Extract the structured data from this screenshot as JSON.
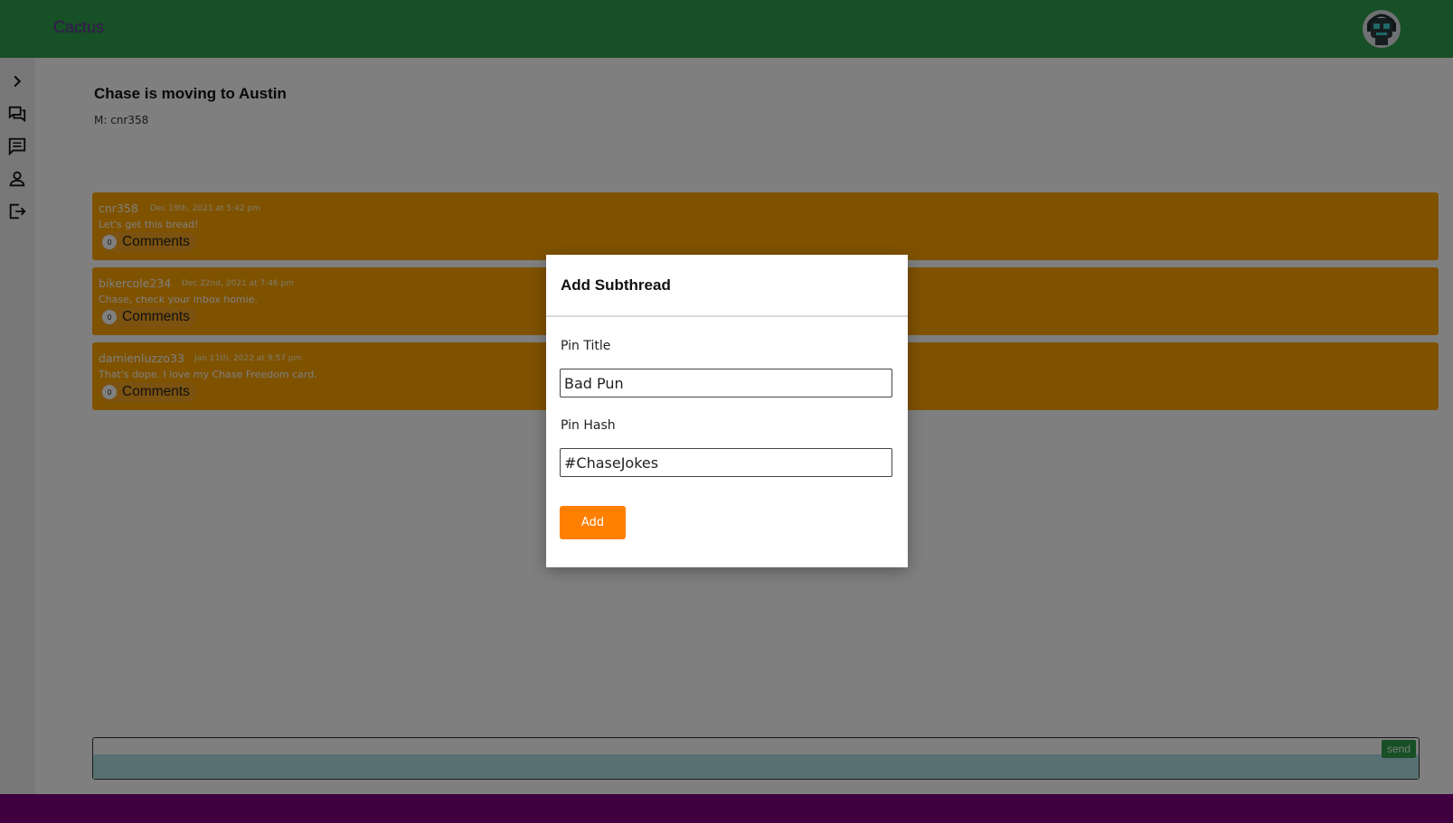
{
  "app": {
    "brand": "Cactus"
  },
  "thread": {
    "title": "Chase is moving to Austin",
    "moderator": "M: cnr358"
  },
  "posts": [
    {
      "user": "cnr358",
      "date": "Dec 19th, 2021 at 5:42 pm",
      "text": "Let's get this bread!",
      "comment_count": "0",
      "comments_label": "Comments"
    },
    {
      "user": "bikercole234",
      "date": "Dec 22nd, 2021 at 7:46 pm",
      "text": "Chase, check your inbox homie.",
      "comment_count": "0",
      "comments_label": "Comments"
    },
    {
      "user": "damienluzzo33",
      "date": "Jan 11th, 2022 at 9:57 pm",
      "text": "That's dope. I love my Chase Freedom card.",
      "comment_count": "0",
      "comments_label": "Comments"
    }
  ],
  "composer": {
    "send_label": "send"
  },
  "modal": {
    "title": "Add Subthread",
    "pin_title_label": "Pin Title",
    "pin_title_value": "Bad Pun",
    "pin_hash_label": "Pin Hash",
    "pin_hash_value": "#ChaseJokes",
    "add_label": "Add"
  },
  "sidebar": {
    "icons": [
      "chevron-right-icon",
      "forum-icon",
      "chat-icon",
      "person-icon",
      "logout-icon"
    ]
  },
  "colors": {
    "header": "#2e9e4c",
    "footer": "#800080",
    "post": "#ffa500",
    "accent": "#ff7f00"
  }
}
